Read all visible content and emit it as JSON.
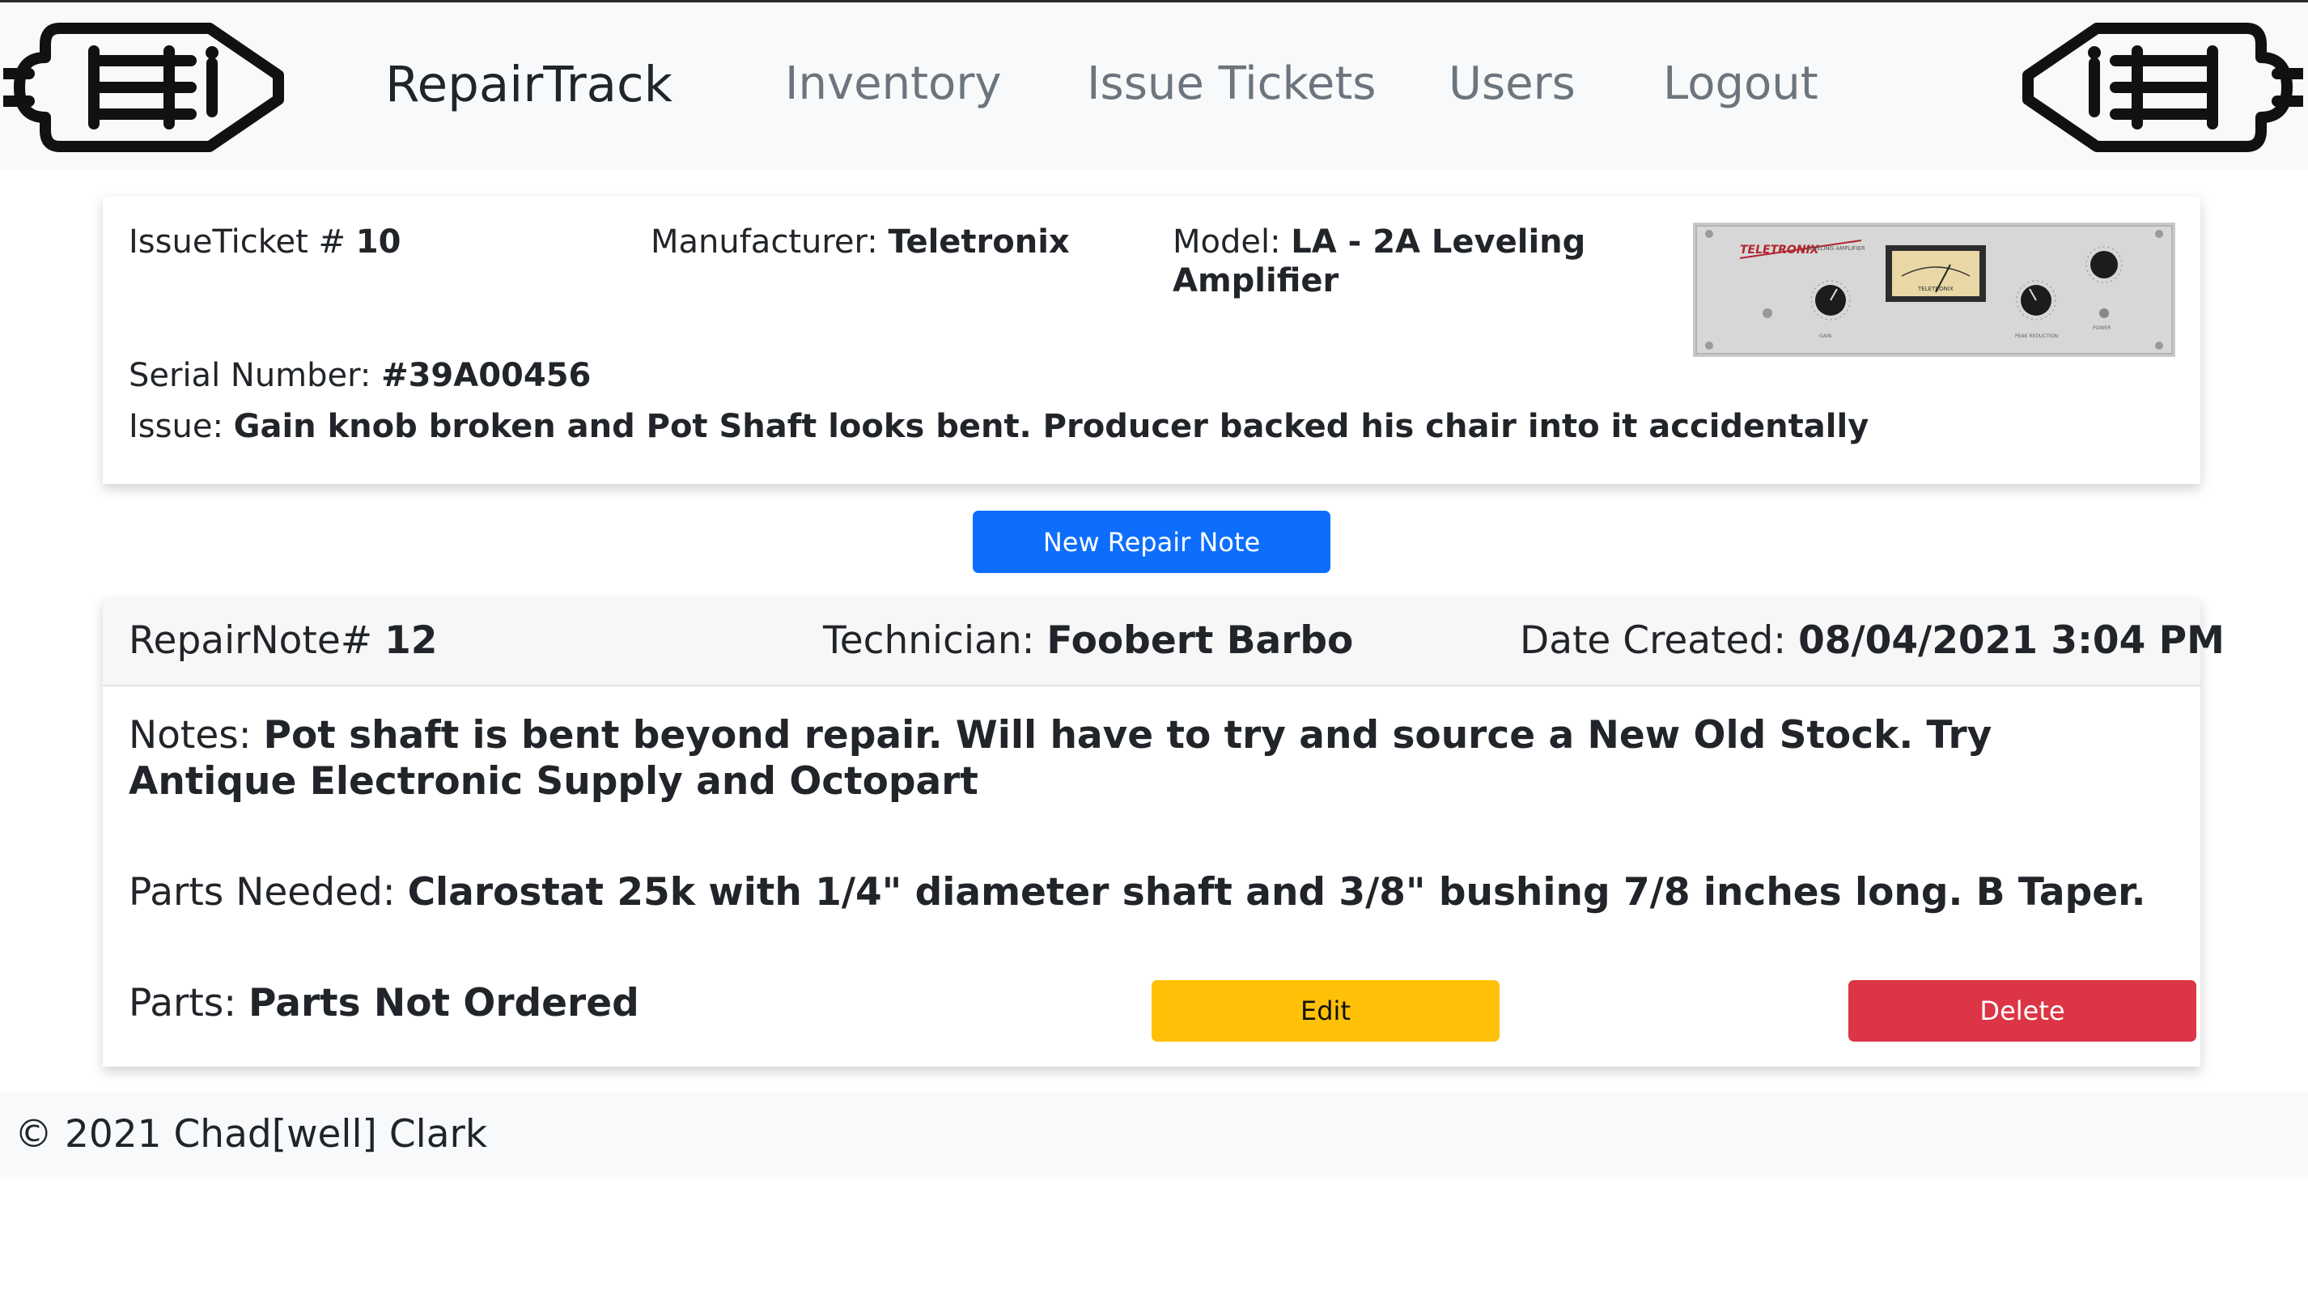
{
  "nav": {
    "brand": "RepairTrack",
    "links": [
      "Inventory",
      "Issue Tickets",
      "Users",
      "Logout"
    ],
    "logo_icon": "vacuum-tube-icon"
  },
  "ticket": {
    "ticket_label": "IssueTicket # ",
    "ticket_number": "10",
    "manufacturer_label": "Manufacturer: ",
    "manufacturer": "Teletronix",
    "model_label": "Model: ",
    "model": "LA - 2A Leveling Amplifier",
    "serial_label": "Serial Number: ",
    "serial": "#39A00456",
    "issue_label": "Issue: ",
    "issue": "Gain knob broken and Pot Shaft looks bent. Producer backed his chair into it accidentally",
    "image": {
      "brand_text": "TELETRONIX",
      "subtitle": "LEVELING AMPLIFIER",
      "meter_text": "TELETRONIX",
      "knob_labels": [
        "GAIN",
        "PEAK REDUCTION",
        "POWER"
      ]
    }
  },
  "new_note_button": "New Repair Note",
  "repair_note": {
    "note_label": "RepairNote# ",
    "note_number": "12",
    "tech_label": "Technician: ",
    "technician": "Foobert Barbo",
    "date_label": "Date Created: ",
    "date": "08/04/2021 3:04 PM",
    "notes_label": "Notes: ",
    "notes": "Pot shaft is bent beyond repair. Will have to try and source a New Old Stock. Try Antique Electronic Supply and Octopart",
    "parts_needed_label": "Parts Needed: ",
    "parts_needed": "Clarostat 25k with 1/4\" diameter shaft and 3/8\" bushing 7/8 inches long. B Taper.",
    "parts_label": "Parts: ",
    "parts": "Parts Not Ordered",
    "edit_button": "Edit",
    "delete_button": "Delete"
  },
  "footer": {
    "copyright": "© 2021 Chad[well] Clark"
  },
  "colors": {
    "primary": "#0d6efd",
    "warning": "#ffc107",
    "danger": "#dc3545",
    "navbar_bg": "#f8f9fa",
    "nav_link": "#6c757d"
  }
}
